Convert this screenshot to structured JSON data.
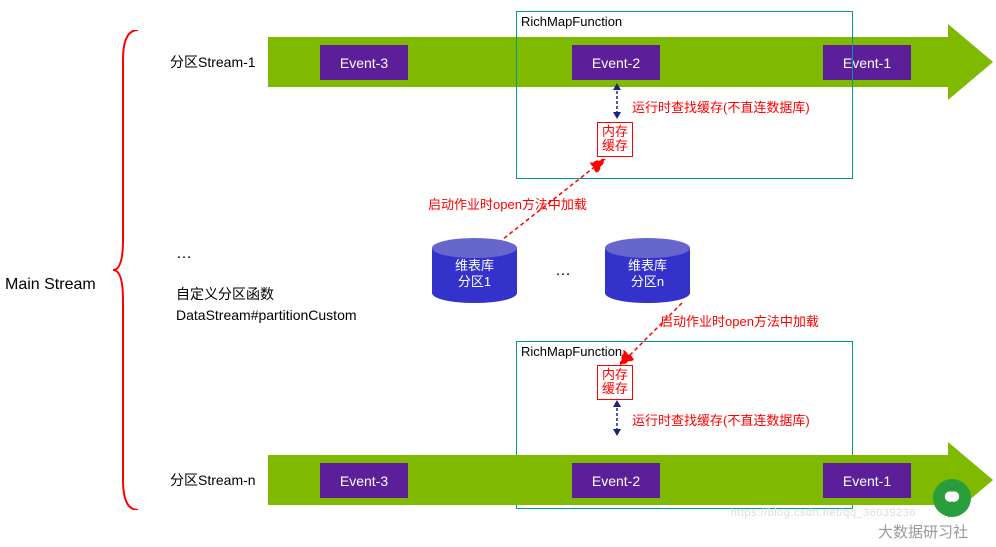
{
  "main_stream_label": "Main Stream",
  "stream_labels": {
    "top": "分区Stream-1",
    "bottom": "分区Stream-n"
  },
  "events": {
    "e1": "Event-1",
    "e2": "Event-2",
    "e3": "Event-3"
  },
  "rich_label": "RichMapFunction",
  "cache_label": "内存\n缓存",
  "runtime_note": "运行时查找缓存(不直连数据库)",
  "startup_note": "启动作业时open方法中加载",
  "db": {
    "left": "维表库\n分区1",
    "right": "维表库\n分区n"
  },
  "db_dots": "…",
  "middle": {
    "dots": "…",
    "line1": "自定义分区函数",
    "line2": "DataStream#partitionCustom"
  },
  "watermark": {
    "text": "大数据研习社",
    "url": "https://blog.csdn.net/qq_36039236"
  }
}
